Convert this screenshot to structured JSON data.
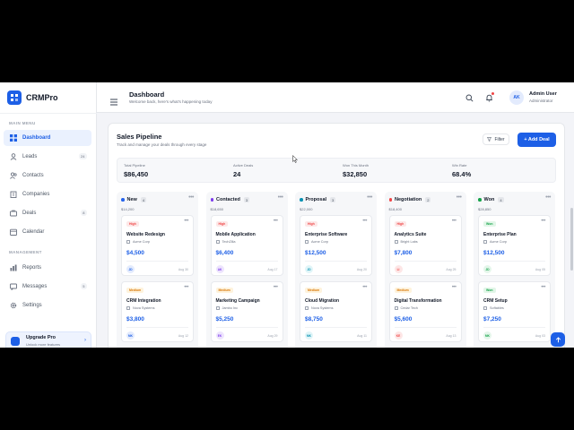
{
  "brand": {
    "name": "CRMPro"
  },
  "sidebar": {
    "main_menu_title": "MAIN MENU",
    "management_title": "MANAGEMENT",
    "items": [
      {
        "label": "Dashboard",
        "icon": "dashboard-icon",
        "active": true
      },
      {
        "label": "Leads",
        "icon": "leads-icon",
        "badge": "24"
      },
      {
        "label": "Contacts",
        "icon": "contacts-icon"
      },
      {
        "label": "Companies",
        "icon": "companies-icon"
      },
      {
        "label": "Deals",
        "icon": "deals-icon",
        "badge": "8"
      },
      {
        "label": "Calendar",
        "icon": "calendar-icon"
      }
    ],
    "management_items": [
      {
        "label": "Reports",
        "icon": "reports-icon"
      },
      {
        "label": "Messages",
        "icon": "messages-icon",
        "badge": "5"
      },
      {
        "label": "Settings",
        "icon": "gear-icon"
      }
    ],
    "upgrade": {
      "title": "Upgrade Pro",
      "subtitle": "Unlock more features"
    }
  },
  "header": {
    "title": "Dashboard",
    "subtitle": "Welcome back, here's what's happening today",
    "user_initials": "AK",
    "user_name": "Admin User",
    "user_role": "Administrator"
  },
  "pipeline": {
    "title": "Sales Pipeline",
    "subtitle": "Track and manage your deals through every stage",
    "filter_label": "Filter",
    "add_label": "+ Add Deal",
    "stats": [
      {
        "label": "Total Pipeline",
        "value": "$86,450"
      },
      {
        "label": "Active Deals",
        "value": "24"
      },
      {
        "label": "Won This Month",
        "value": "$32,850"
      },
      {
        "label": "Win Rate",
        "value": "68.4%"
      }
    ],
    "columns": [
      {
        "name": "New",
        "count": "4",
        "total": "$14,200",
        "color": "#2563eb"
      },
      {
        "name": "Contacted",
        "count": "3",
        "total": "$18,650",
        "color": "#7c3aed"
      },
      {
        "name": "Proposal",
        "count": "3",
        "total": "$22,000",
        "color": "#0891b2"
      },
      {
        "name": "Negotiation",
        "count": "2",
        "total": "$18,400",
        "color": "#ef4444"
      },
      {
        "name": "Won",
        "count": "4",
        "total": "$28,850",
        "color": "#16a34a"
      }
    ],
    "cards": [
      [
        {
          "priority": "High",
          "title": "Website Redesign",
          "company": "Acme Corp",
          "amount": "$4,500",
          "initials": "JD",
          "date": "Aug 30"
        },
        {
          "priority": "Medium",
          "title": "CRM Integration",
          "company": "Nova Systems",
          "amount": "$3,800",
          "initials": "MK",
          "date": "Aug 12"
        }
      ],
      [
        {
          "priority": "High",
          "title": "Mobile Application",
          "company": "TechZilla",
          "amount": "$6,400",
          "initials": "AK",
          "date": "Aug 17"
        },
        {
          "priority": "Medium",
          "title": "Marketing Campaign",
          "company": "Jambo Inc",
          "amount": "$5,250",
          "initials": "EK",
          "date": "Aug 29"
        }
      ],
      [
        {
          "priority": "High",
          "title": "Enterprise Software",
          "company": "Acme Corp",
          "amount": "$12,500",
          "initials": "JD",
          "date": "Aug 20"
        },
        {
          "priority": "Medium",
          "title": "Cloud Migration",
          "company": "Nova Systems",
          "amount": "$8,750",
          "initials": "MK",
          "date": "Aug 11"
        }
      ],
      [
        {
          "priority": "High",
          "title": "Analytics Suite",
          "company": "Bright Labs",
          "amount": "$7,800",
          "initials": "LI",
          "date": "Aug 25"
        },
        {
          "priority": "Medium",
          "title": "Digital Transformation",
          "company": "Cedar Tech",
          "amount": "$5,600",
          "initials": "KE",
          "date": "Aug 13"
        }
      ],
      [
        {
          "priority": "Won",
          "title": "Enterprise Plan",
          "company": "Acme Corp",
          "amount": "$12,500",
          "initials": "JD",
          "date": "Aug 05"
        },
        {
          "priority": "Won",
          "title": "CRM Setup",
          "company": "Softables",
          "amount": "$7,250",
          "initials": "MK",
          "date": "Aug 03"
        }
      ]
    ]
  },
  "colors": {
    "accent": "#1d5fe6",
    "high": "#ef4444",
    "medium": "#d97706",
    "won": "#16a34a"
  }
}
